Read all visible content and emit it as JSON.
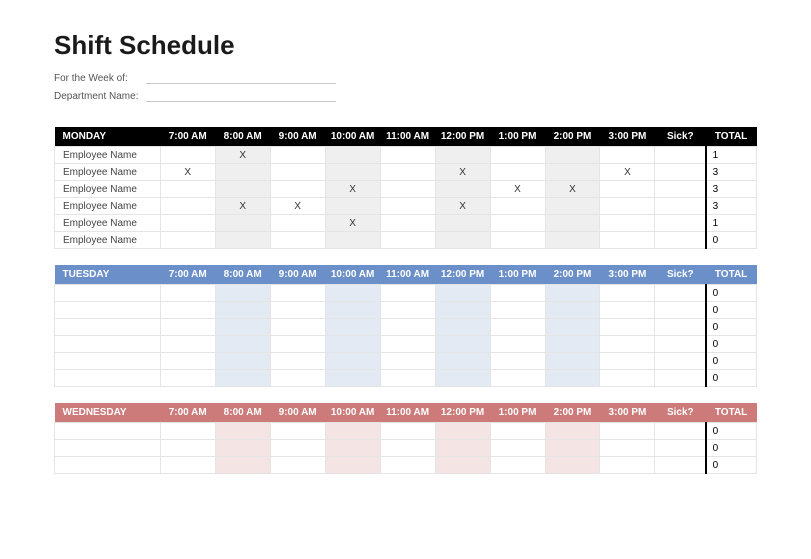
{
  "title": "Shift Schedule",
  "meta": {
    "week_label": "For the Week of:",
    "dept_label": "Department Name:"
  },
  "time_headers": [
    "7:00 AM",
    "8:00 AM",
    "9:00 AM",
    "10:00 AM",
    "11:00 AM",
    "12:00 PM",
    "1:00 PM",
    "2:00 PM",
    "3:00 PM"
  ],
  "sick_header": "Sick?",
  "total_header": "TOTAL",
  "days": [
    {
      "name": "MONDAY",
      "theme": "black",
      "rows": [
        {
          "emp": "Employee Name",
          "cells": [
            "",
            "X",
            "",
            "",
            "",
            "",
            "",
            "",
            "",
            ""
          ],
          "total": "1"
        },
        {
          "emp": "Employee Name",
          "cells": [
            "X",
            "",
            "",
            "",
            "",
            "X",
            "",
            "",
            "X",
            ""
          ],
          "total": "3"
        },
        {
          "emp": "Employee Name",
          "cells": [
            "",
            "",
            "",
            "X",
            "",
            "",
            "X",
            "X",
            "",
            ""
          ],
          "total": "3"
        },
        {
          "emp": "Employee Name",
          "cells": [
            "",
            "X",
            "X",
            "",
            "",
            "X",
            "",
            "",
            "",
            ""
          ],
          "total": "3"
        },
        {
          "emp": "Employee Name",
          "cells": [
            "",
            "",
            "",
            "X",
            "",
            "",
            "",
            "",
            "",
            ""
          ],
          "total": "1"
        },
        {
          "emp": "Employee Name",
          "cells": [
            "",
            "",
            "",
            "",
            "",
            "",
            "",
            "",
            "",
            ""
          ],
          "total": "0"
        }
      ]
    },
    {
      "name": "TUESDAY",
      "theme": "blue",
      "rows": [
        {
          "emp": "",
          "cells": [
            "",
            "",
            "",
            "",
            "",
            "",
            "",
            "",
            "",
            ""
          ],
          "total": "0"
        },
        {
          "emp": "",
          "cells": [
            "",
            "",
            "",
            "",
            "",
            "",
            "",
            "",
            "",
            ""
          ],
          "total": "0"
        },
        {
          "emp": "",
          "cells": [
            "",
            "",
            "",
            "",
            "",
            "",
            "",
            "",
            "",
            ""
          ],
          "total": "0"
        },
        {
          "emp": "",
          "cells": [
            "",
            "",
            "",
            "",
            "",
            "",
            "",
            "",
            "",
            ""
          ],
          "total": "0"
        },
        {
          "emp": "",
          "cells": [
            "",
            "",
            "",
            "",
            "",
            "",
            "",
            "",
            "",
            ""
          ],
          "total": "0"
        },
        {
          "emp": "",
          "cells": [
            "",
            "",
            "",
            "",
            "",
            "",
            "",
            "",
            "",
            ""
          ],
          "total": "0"
        }
      ]
    },
    {
      "name": "WEDNESDAY",
      "theme": "red",
      "rows": [
        {
          "emp": "",
          "cells": [
            "",
            "",
            "",
            "",
            "",
            "",
            "",
            "",
            "",
            ""
          ],
          "total": "0"
        },
        {
          "emp": "",
          "cells": [
            "",
            "",
            "",
            "",
            "",
            "",
            "",
            "",
            "",
            ""
          ],
          "total": "0"
        },
        {
          "emp": "",
          "cells": [
            "",
            "",
            "",
            "",
            "",
            "",
            "",
            "",
            "",
            ""
          ],
          "total": "0"
        }
      ]
    }
  ]
}
